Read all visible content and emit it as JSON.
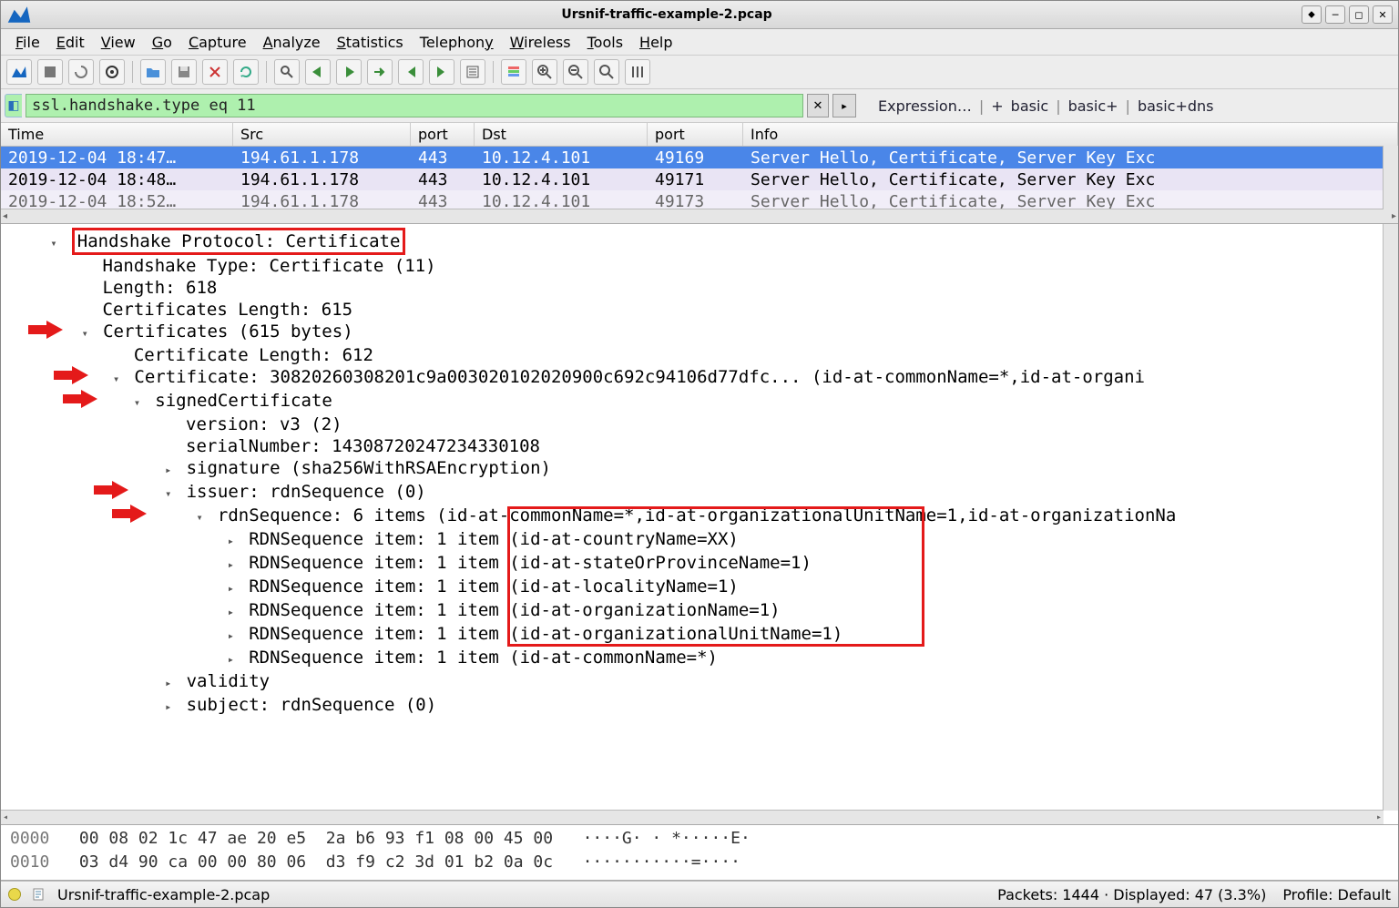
{
  "window": {
    "title": "Ursnif-traffic-example-2.pcap"
  },
  "menu": {
    "file": "File",
    "edit": "Edit",
    "view": "View",
    "go": "Go",
    "capture": "Capture",
    "analyze": "Analyze",
    "statistics": "Statistics",
    "telephony": "Telephony",
    "wireless": "Wireless",
    "tools": "Tools",
    "help": "Help"
  },
  "filter": {
    "value": "ssl.handshake.type eq 11",
    "expression": "Expression…",
    "plus": "+",
    "basic": "basic",
    "basicplus": "basic+",
    "basicdns": "basic+dns"
  },
  "columns": {
    "time": "Time",
    "src": "Src",
    "sport": "port",
    "dst": "Dst",
    "dport": "port",
    "info": "Info"
  },
  "rows": [
    {
      "time": "2019-12-04 18:47…",
      "src": "194.61.1.178",
      "sport": "443",
      "dst": "10.12.4.101",
      "dport": "49169",
      "info": "Server Hello, Certificate, Server Key Exc"
    },
    {
      "time": "2019-12-04 18:48…",
      "src": "194.61.1.178",
      "sport": "443",
      "dst": "10.12.4.101",
      "dport": "49171",
      "info": "Server Hello, Certificate, Server Key Exc"
    },
    {
      "time": "2019-12-04 18:52…",
      "src": "194.61.1.178",
      "sport": "443",
      "dst": "10.12.4.101",
      "dport": "49173",
      "info": "Server Hello, Certificate, Server Key Exc"
    }
  ],
  "details": {
    "l0": "Handshake Protocol: Certificate",
    "l1": "Handshake Type: Certificate (11)",
    "l2": "Length: 618",
    "l3": "Certificates Length: 615",
    "l4": "Certificates (615 bytes)",
    "l5": "Certificate Length: 612",
    "l6": "Certificate: 30820260308201c9a003020102020900c692c94106d77dfc... (id-at-commonName=*,id-at-organi",
    "l7": "signedCertificate",
    "l8": "version: v3 (2)",
    "l9": "serialNumber: 14308720247234330108",
    "l10": "signature (sha256WithRSAEncryption)",
    "l11": "issuer: rdnSequence (0)",
    "l12": "rdnSequence: 6 items (id-at-commonName=*,id-at-organizationalUnitName=1,id-at-organizationNa",
    "l13": "RDNSequence item: 1 item (id-at-countryName=XX)",
    "l14": "RDNSequence item: 1 item (id-at-stateOrProvinceName=1)",
    "l15": "RDNSequence item: 1 item (id-at-localityName=1)",
    "l16": "RDNSequence item: 1 item (id-at-organizationName=1)",
    "l17": "RDNSequence item: 1 item (id-at-organizationalUnitName=1)",
    "l18": "RDNSequence item: 1 item (id-at-commonName=*)",
    "l19": "validity",
    "l20": "subject: rdnSequence (0)"
  },
  "hex": {
    "r0_off": "0000",
    "r0_hex": "00 08 02 1c 47 ae 20 e5  2a b6 93 f1 08 00 45 00",
    "r0_asc": "····G· · *·····E·",
    "r1_off": "0010",
    "r1_hex": "03 d4 90 ca 00 00 80 06  d3 f9 c2 3d 01 b2 0a 0c",
    "r1_asc": "···········=····"
  },
  "status": {
    "file": "Ursnif-traffic-example-2.pcap",
    "packets": "Packets: 1444 · Displayed: 47 (3.3%)",
    "profile": "Profile: Default"
  }
}
